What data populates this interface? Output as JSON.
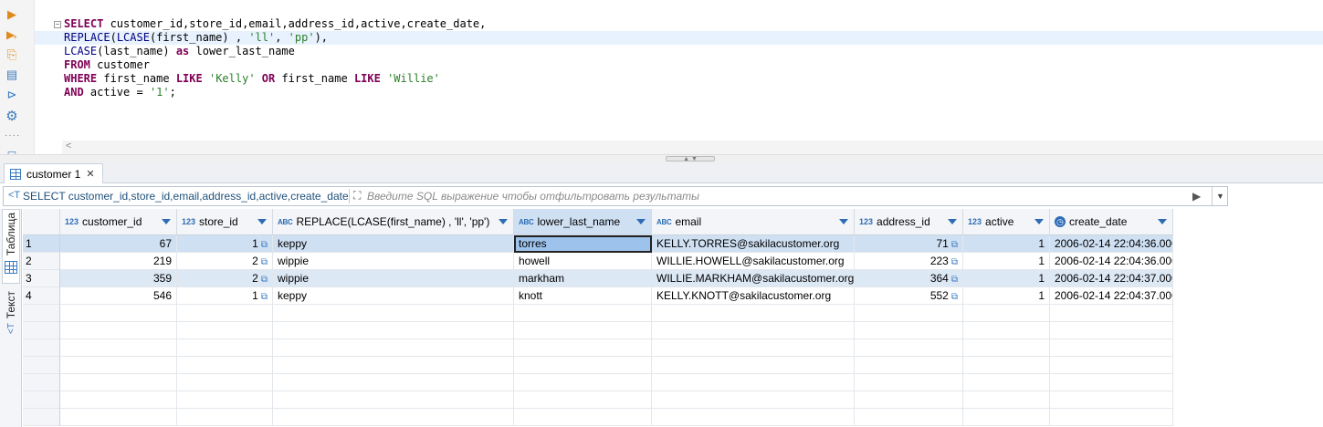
{
  "editor": {
    "gutter_icons": [
      "execute-statement-icon",
      "execute-script-icon",
      "execution-plan-icon",
      "load-script-icon",
      "terminal-icon",
      "settings-icon"
    ],
    "lines": [
      [
        {
          "t": "SELECT ",
          "c": "kw"
        },
        {
          "t": "customer_id,store_id,email,address_id,active,create_date,",
          "c": ""
        }
      ],
      [
        {
          "t": "REPLACE",
          "c": "kw2"
        },
        {
          "t": "(",
          "c": ""
        },
        {
          "t": "LCASE",
          "c": "kw2"
        },
        {
          "t": "(first_name) , ",
          "c": ""
        },
        {
          "t": "'ll'",
          "c": "str"
        },
        {
          "t": ", ",
          "c": ""
        },
        {
          "t": "'pp'",
          "c": "str"
        },
        {
          "t": "),",
          "c": ""
        }
      ],
      [
        {
          "t": "LCASE",
          "c": "kw2"
        },
        {
          "t": "(last_name) ",
          "c": ""
        },
        {
          "t": "as",
          "c": "kw"
        },
        {
          "t": " lower_last_name",
          "c": ""
        }
      ],
      [
        {
          "t": "FROM",
          "c": "kw"
        },
        {
          "t": " customer",
          "c": ""
        }
      ],
      [
        {
          "t": "WHERE",
          "c": "kw"
        },
        {
          "t": " first_name ",
          "c": ""
        },
        {
          "t": "LIKE",
          "c": "kw"
        },
        {
          "t": " ",
          "c": ""
        },
        {
          "t": "'Kelly'",
          "c": "str"
        },
        {
          "t": " ",
          "c": ""
        },
        {
          "t": "OR",
          "c": "kw"
        },
        {
          "t": " first_name ",
          "c": ""
        },
        {
          "t": "LIKE",
          "c": "kw"
        },
        {
          "t": " ",
          "c": ""
        },
        {
          "t": "'Willie'",
          "c": "str"
        }
      ],
      [
        {
          "t": "AND",
          "c": "kw"
        },
        {
          "t": " active = ",
          "c": ""
        },
        {
          "t": "'1'",
          "c": "str"
        },
        {
          "t": ";",
          "c": ""
        }
      ]
    ]
  },
  "results": {
    "tab_label": "customer 1",
    "filter": {
      "sql": "SELECT customer_id,store_id,email,address_id,active,create_date, R",
      "placeholder": "Введите SQL выражение чтобы отфильтровать результаты"
    },
    "side_tabs": {
      "table": "Таблица",
      "text": "Текст"
    },
    "columns": [
      {
        "name": "customer_id",
        "type": "123"
      },
      {
        "name": "store_id",
        "type": "123"
      },
      {
        "name": "REPLACE(LCASE(first_name) , 'll', 'pp')",
        "type": "ABC"
      },
      {
        "name": "lower_last_name",
        "type": "ABC"
      },
      {
        "name": "email",
        "type": "ABC"
      },
      {
        "name": "address_id",
        "type": "123"
      },
      {
        "name": "active",
        "type": "123"
      },
      {
        "name": "create_date",
        "type": "clock"
      }
    ],
    "rows": [
      [
        "1",
        "67",
        "1",
        "keppy",
        "torres",
        "KELLY.TORRES@sakilacustomer.org",
        "71",
        "1",
        "2006-02-14 22:04:36.000"
      ],
      [
        "2",
        "219",
        "2",
        "wippie",
        "howell",
        "WILLIE.HOWELL@sakilacustomer.org",
        "223",
        "1",
        "2006-02-14 22:04:36.000"
      ],
      [
        "3",
        "359",
        "2",
        "wippie",
        "markham",
        "WILLIE.MARKHAM@sakilacustomer.org",
        "364",
        "1",
        "2006-02-14 22:04:37.000"
      ],
      [
        "4",
        "546",
        "1",
        "keppy",
        "knott",
        "KELLY.KNOTT@sakilacustomer.org",
        "552",
        "1",
        "2006-02-14 22:04:37.000"
      ]
    ]
  },
  "colors": {
    "keyword": "#7f0055",
    "function": "#000080",
    "string": "#2a7f2a",
    "selection": "#cfe0f3",
    "accent": "#3a7bbf"
  }
}
